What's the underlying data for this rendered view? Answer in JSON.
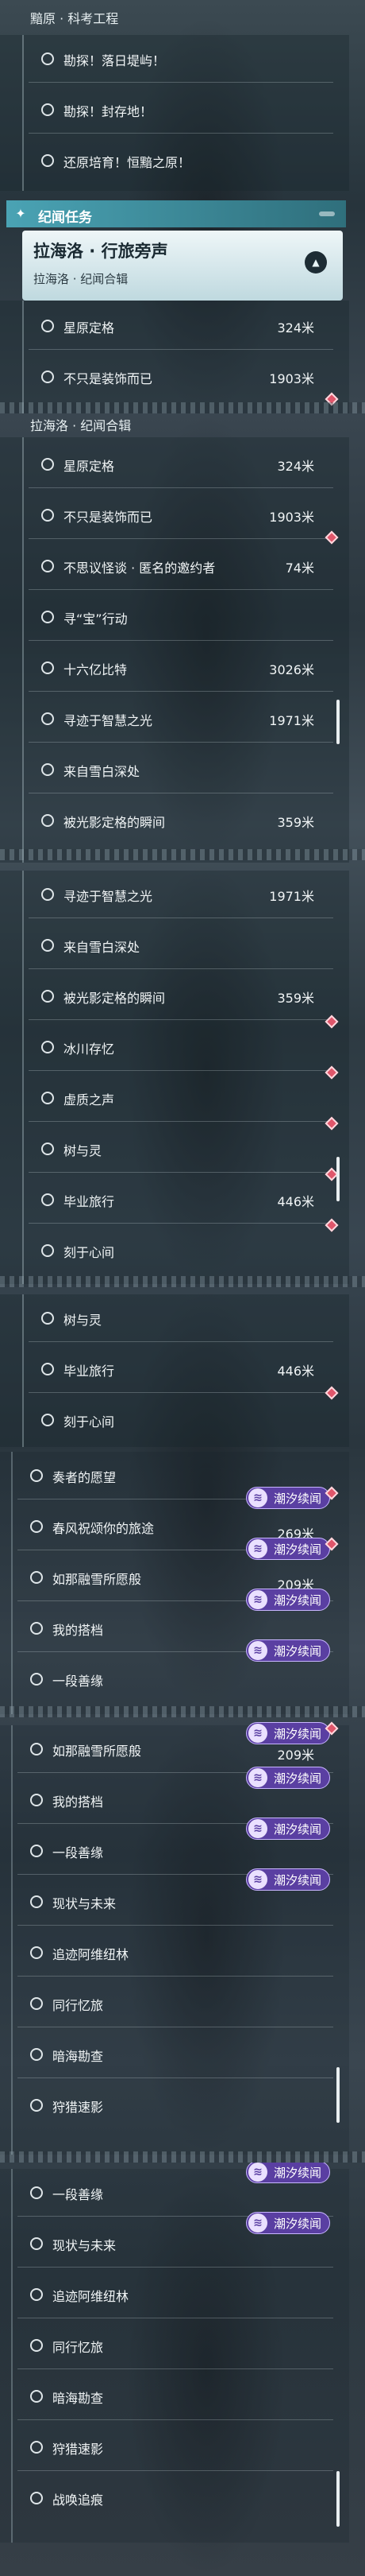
{
  "s1": {
    "topbar": "黯原 · 科考工程",
    "items": [
      "勘探！落日堤屿！",
      "勘探！封存地！",
      "还原培育！恒黯之原！"
    ],
    "section_title": "纪闻任务",
    "quest_title": "拉海洛 · 行旅旁声",
    "quest_sub": "拉海洛 · 纪闻合辑",
    "rows": [
      {
        "label": "星原定格",
        "dist": "324米"
      },
      {
        "label": "不只是装饰而已",
        "dist": "1903米"
      }
    ]
  },
  "s2": {
    "topbar": "拉海洛 · 纪闻合辑",
    "rows": [
      {
        "label": "星原定格",
        "dist": "324米"
      },
      {
        "label": "不只是装饰而已",
        "dist": "1903米"
      },
      {
        "label": "不思议怪谈 · 匿名的邀约者",
        "dist": "74米"
      },
      {
        "label": "寻“宝”行动",
        "dist": ""
      },
      {
        "label": "十六亿比特",
        "dist": "3026米"
      },
      {
        "label": "寻迹于智慧之光",
        "dist": "1971米"
      },
      {
        "label": "来自雪白深处",
        "dist": ""
      },
      {
        "label": "被光影定格的瞬间",
        "dist": "359米"
      }
    ]
  },
  "s3": {
    "rows": [
      {
        "label": "寻迹于智慧之光",
        "dist": "1971米"
      },
      {
        "label": "来自雪白深处",
        "dist": ""
      },
      {
        "label": "被光影定格的瞬间",
        "dist": "359米"
      },
      {
        "label": "冰川存忆",
        "dist": ""
      },
      {
        "label": "虚质之声",
        "dist": ""
      },
      {
        "label": "树与灵",
        "dist": ""
      },
      {
        "label": "毕业旅行",
        "dist": "446米"
      },
      {
        "label": "刻于心间",
        "dist": ""
      }
    ]
  },
  "s4": {
    "rows": [
      {
        "label": "树与灵",
        "dist": ""
      },
      {
        "label": "毕业旅行",
        "dist": "446米"
      },
      {
        "label": "刻于心间",
        "dist": ""
      },
      {
        "label": "奏者的愿望",
        "dist": ""
      },
      {
        "label": "春风祝颂你的旅途",
        "dist": "269米"
      },
      {
        "label": "如那融雪所愿般",
        "dist": "209米"
      },
      {
        "label": "我的搭档",
        "dist": ""
      },
      {
        "label": "一段善缘",
        "dist": ""
      }
    ],
    "badge": "潮汐续闻"
  },
  "s5": {
    "rows": [
      {
        "label": "如那融雪所愿般",
        "dist": "209米"
      },
      {
        "label": "我的搭档",
        "dist": ""
      },
      {
        "label": "一段善缘",
        "dist": ""
      },
      {
        "label": "现状与未来",
        "dist": ""
      },
      {
        "label": "追迹阿维纽林",
        "dist": ""
      },
      {
        "label": "同行忆旅",
        "dist": ""
      },
      {
        "label": "暗海勘查",
        "dist": ""
      },
      {
        "label": "狩猎速影",
        "dist": ""
      }
    ],
    "badge": "潮汐续闻"
  },
  "s6": {
    "rows": [
      {
        "label": "一段善缘",
        "dist": ""
      },
      {
        "label": "现状与未来",
        "dist": ""
      },
      {
        "label": "追迹阿维纽林",
        "dist": ""
      },
      {
        "label": "同行忆旅",
        "dist": ""
      },
      {
        "label": "暗海勘查",
        "dist": ""
      },
      {
        "label": "狩猎速影",
        "dist": ""
      },
      {
        "label": "战唤追痕",
        "dist": ""
      }
    ],
    "badge": "潮汐续闻"
  },
  "colors": {
    "accent": "#4aa3b4",
    "badge": "#5a3fa2",
    "marker": "#e0566b"
  },
  "icons": {
    "radio": "radio-circle-icon",
    "marker": "diamond-marker-icon",
    "badge": "tide-news-icon",
    "collapse": "chevron-up-icon",
    "section": "plus-star-icon"
  }
}
